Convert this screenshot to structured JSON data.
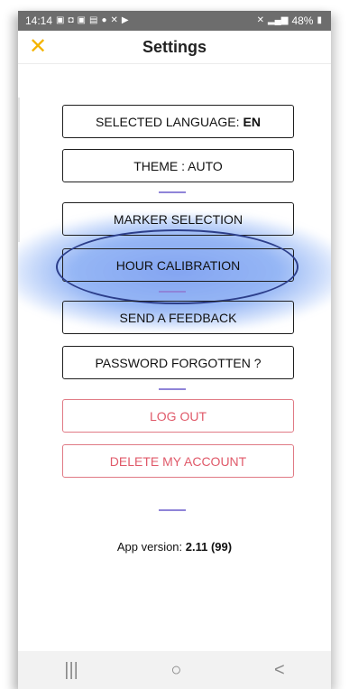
{
  "status_bar": {
    "time": "14:14",
    "battery": "48%"
  },
  "header": {
    "title": "Settings",
    "close_icon": "close-icon",
    "accent_color": "#f4b400"
  },
  "settings": {
    "language_label": "SELECTED LANGUAGE:",
    "language_value": "EN",
    "theme": "THEME : AUTO",
    "marker": "MARKER SELECTION",
    "hour_calibration": "HOUR CALIBRATION",
    "feedback": "SEND A FEEDBACK",
    "password": "PASSWORD FORGOTTEN ?",
    "logout": "LOG OUT",
    "delete_account": "DELETE MY ACCOUNT"
  },
  "footer": {
    "version_label": "App version:",
    "version_value": "2.11 (99)"
  },
  "nav": {
    "recent": "|||",
    "home": "○",
    "back": "<"
  },
  "colors": {
    "danger": "#e05a6a",
    "separator": "#8f84d8",
    "highlight": "#2c6be6"
  }
}
